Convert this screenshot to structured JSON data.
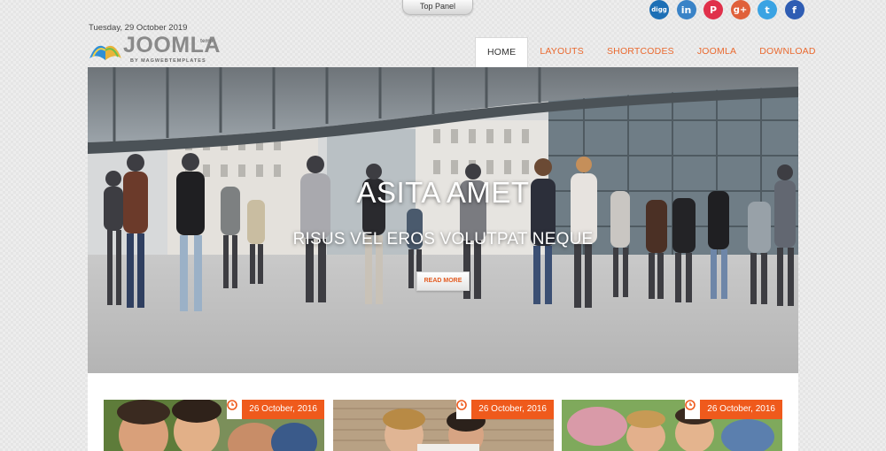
{
  "top_panel": {
    "label": "Top Panel"
  },
  "social": [
    {
      "name": "digg-icon",
      "glyph": "digg"
    },
    {
      "name": "linkedin-icon",
      "glyph": "in"
    },
    {
      "name": "pinterest-icon",
      "glyph": "P"
    },
    {
      "name": "google-plus-icon",
      "glyph": "g+"
    },
    {
      "name": "twitter-icon",
      "glyph": "t"
    },
    {
      "name": "facebook-icon",
      "glyph": "f"
    }
  ],
  "header": {
    "date": "Tuesday, 29 October 2019",
    "logo_word": "JOOMLA",
    "logo_sup": "temp",
    "logo_sub": "BY MAGWEBTEMPLATES"
  },
  "nav": {
    "items": [
      {
        "label": "HOME",
        "active": true
      },
      {
        "label": "LAYOUTS",
        "active": false
      },
      {
        "label": "SHORTCODES",
        "active": false
      },
      {
        "label": "JOOMLA",
        "active": false
      },
      {
        "label": "DOWNLOAD",
        "active": false
      }
    ]
  },
  "hero": {
    "title": "ASITA AMET",
    "subtitle": "RISUS VEL EROS VOLUTPAT NEQUE",
    "button": "READ MORE"
  },
  "cards": [
    {
      "date": "26 October, 2016"
    },
    {
      "date": "26 October, 2016"
    },
    {
      "date": "26 October, 2016"
    }
  ],
  "colors": {
    "accent": "#ef5a1c",
    "nav_link": "#ea6a30",
    "page_bg": "#ededed"
  }
}
